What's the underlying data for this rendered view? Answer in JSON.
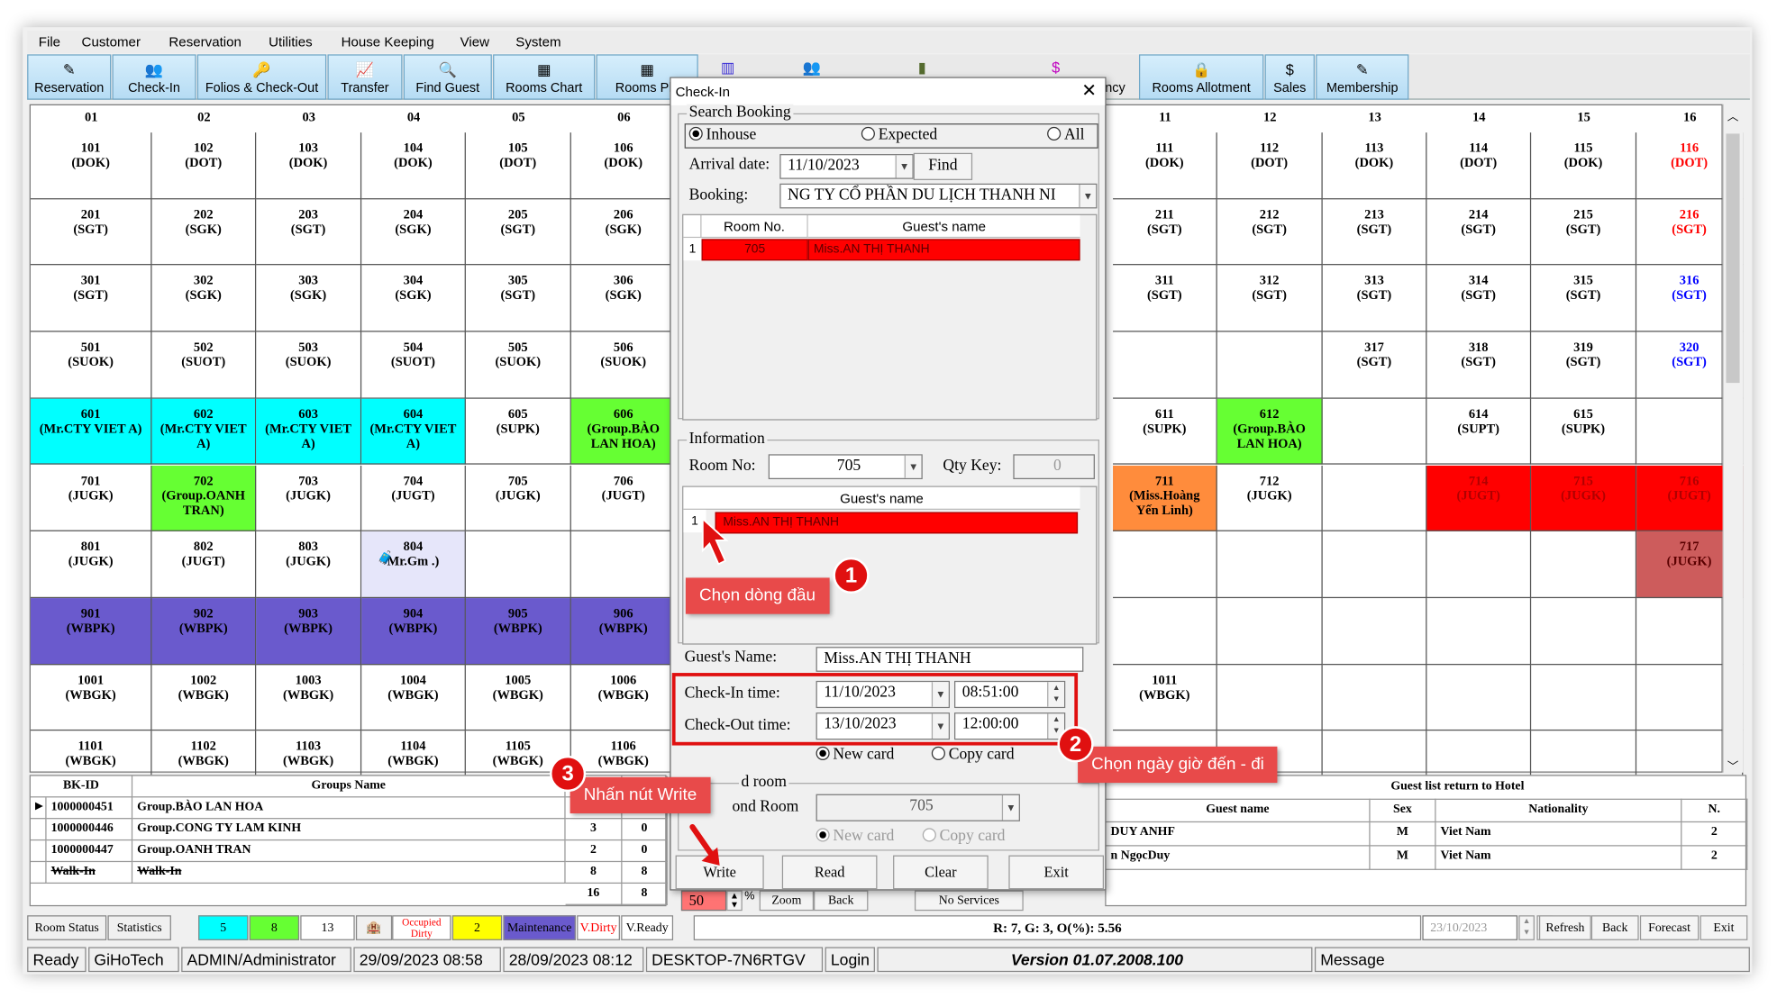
{
  "menu": [
    "File",
    "Customer",
    "Reservation",
    "Utilities",
    "House Keeping",
    "View",
    "System"
  ],
  "toolbar": [
    {
      "label": "Reservation",
      "icon": "✎"
    },
    {
      "label": "Check-In",
      "icon": "👥"
    },
    {
      "label": "Folios & Check-Out",
      "icon": "🔑"
    },
    {
      "label": "Transfer",
      "icon": "📈"
    },
    {
      "label": "Find Guest",
      "icon": "🔍"
    },
    {
      "label": "Rooms Chart",
      "icon": "▦"
    },
    {
      "label": "Rooms Pla",
      "icon": "▦"
    },
    {
      "label": "",
      "icon": "▥"
    },
    {
      "label": "",
      "icon": "👥"
    },
    {
      "label": "",
      "icon": "▮"
    },
    {
      "label": "",
      "icon": "$"
    },
    {
      "label": "ncy",
      "icon": ""
    },
    {
      "label": "Rooms Allotment",
      "icon": "🔒"
    },
    {
      "label": "Sales",
      "icon": "$"
    },
    {
      "label": "Membership",
      "icon": "✎"
    }
  ],
  "grid": {
    "left_headers": [
      "01",
      "02",
      "03",
      "04",
      "05",
      "06"
    ],
    "right_headers": [
      "11",
      "12",
      "13",
      "14",
      "15",
      "16"
    ],
    "left_rows": [
      [
        {
          "t": "101\n(DOK)"
        },
        {
          "t": "102\n(DOT)"
        },
        {
          "t": "103\n(DOK)"
        },
        {
          "t": "104\n(DOK)"
        },
        {
          "t": "105\n(DOT)"
        },
        {
          "t": "106\n(DOK)"
        }
      ],
      [
        {
          "t": "201\n(SGT)"
        },
        {
          "t": "202\n(SGK)"
        },
        {
          "t": "203\n(SGT)"
        },
        {
          "t": "204\n(SGK)"
        },
        {
          "t": "205\n(SGT)"
        },
        {
          "t": "206\n(SGK)"
        }
      ],
      [
        {
          "t": "301\n(SGT)"
        },
        {
          "t": "302\n(SGK)"
        },
        {
          "t": "303\n(SGK)"
        },
        {
          "t": "304\n(SGK)"
        },
        {
          "t": "305\n(SGT)"
        },
        {
          "t": "306\n(SGK)"
        }
      ],
      [
        {
          "t": "501\n(SUOK)"
        },
        {
          "t": "502\n(SUOT)"
        },
        {
          "t": "503\n(SUOK)"
        },
        {
          "t": "504\n(SUOT)"
        },
        {
          "t": "505\n(SUOK)"
        },
        {
          "t": "506\n(SUOK)"
        }
      ],
      [
        {
          "t": "601\n(Mr.CTY VIET A)",
          "bg": "#00ffff"
        },
        {
          "t": "602\n(Mr.CTY VIET\nA)",
          "bg": "#00ffff"
        },
        {
          "t": "603\n(Mr.CTY VIET\nA)",
          "bg": "#00ffff"
        },
        {
          "t": "604\n(Mr.CTY VIET\nA)",
          "bg": "#00ffff"
        },
        {
          "t": "605\n(SUPK)"
        },
        {
          "t": "606\n(Group.BÀO\nLAN HOA)",
          "bg": "#66ff33"
        }
      ],
      [
        {
          "t": "701\n(JUGK)"
        },
        {
          "t": "702\n(Group.OANH\nTRAN)",
          "bg": "#66ff33"
        },
        {
          "t": "703\n(JUGK)"
        },
        {
          "t": "704\n(JUGT)"
        },
        {
          "t": "705\n(JUGK)"
        },
        {
          "t": "706\n(JUGT)"
        }
      ],
      [
        {
          "t": "801\n(JUGK)"
        },
        {
          "t": "802\n(JUGT)"
        },
        {
          "t": "803\n(JUGK)"
        },
        {
          "t": "804\nMr.Gm .)",
          "bg": "#e6e6fa",
          "ico": true
        },
        {
          "t": ""
        },
        {
          "t": ""
        }
      ],
      [
        {
          "t": "901\n(WBPK)",
          "bg": "#6a5acd"
        },
        {
          "t": "902\n(WBPK)",
          "bg": "#6a5acd"
        },
        {
          "t": "903\n(WBPK)",
          "bg": "#6a5acd"
        },
        {
          "t": "904\n(WBPK)",
          "bg": "#6a5acd"
        },
        {
          "t": "905\n(WBPK)",
          "bg": "#6a5acd"
        },
        {
          "t": "906\n(WBPK)",
          "bg": "#6a5acd"
        }
      ],
      [
        {
          "t": "1001\n(WBGK)"
        },
        {
          "t": "1002\n(WBGK)"
        },
        {
          "t": "1003\n(WBGK)"
        },
        {
          "t": "1004\n(WBGK)"
        },
        {
          "t": "1005\n(WBGK)"
        },
        {
          "t": "1006\n(WBGK)"
        }
      ],
      [
        {
          "t": "1101\n(WBGK)"
        },
        {
          "t": "1102\n(WBGK)"
        },
        {
          "t": "1103\n(WBGK)"
        },
        {
          "t": "1104\n(WBGK)"
        },
        {
          "t": "1105\n(WBGK)"
        },
        {
          "t": "1106\n(WBGK)"
        }
      ]
    ],
    "right_rows": [
      [
        {
          "t": "111\n(DOK)"
        },
        {
          "t": "112\n(DOT)"
        },
        {
          "t": "113\n(DOK)"
        },
        {
          "t": "114\n(DOT)"
        },
        {
          "t": "115\n(DOK)"
        },
        {
          "t": "116\n(DOT)",
          "fg": "#ff0000"
        }
      ],
      [
        {
          "t": "211\n(SGT)"
        },
        {
          "t": "212\n(SGT)"
        },
        {
          "t": "213\n(SGT)"
        },
        {
          "t": "214\n(SGT)"
        },
        {
          "t": "215\n(SGT)"
        },
        {
          "t": "216\n(SGT)",
          "fg": "#ff0000"
        }
      ],
      [
        {
          "t": "311\n(SGT)"
        },
        {
          "t": "312\n(SGT)"
        },
        {
          "t": "313\n(SGT)"
        },
        {
          "t": "314\n(SGT)"
        },
        {
          "t": "315\n(SGT)"
        },
        {
          "t": "316\n(SGT)",
          "fg": "#0000ff"
        }
      ],
      [
        {
          "t": ""
        },
        {
          "t": ""
        },
        {
          "t": "317\n(SGT)"
        },
        {
          "t": "318\n(SGT)"
        },
        {
          "t": "319\n(SGT)"
        },
        {
          "t": "320\n(SGT)",
          "fg": "#0000ff"
        }
      ],
      [
        {
          "t": "611\n(SUPK)"
        },
        {
          "t": "612\n(Group.BÀO\nLAN HOA)",
          "bg": "#66ff33"
        },
        {
          "t": ""
        },
        {
          "t": "614\n(SUPT)"
        },
        {
          "t": "615\n(SUPK)"
        },
        {
          "t": ""
        }
      ],
      [
        {
          "t": "711\n(Miss.Hoàng\nYến Linh)",
          "bg": "#ff8c3c"
        },
        {
          "t": "712\n(JUGK)"
        },
        {
          "t": ""
        },
        {
          "t": "714\n(JUGT)",
          "bg": "#ff0000",
          "fg": "#b00000"
        },
        {
          "t": "715\n(JUGK)",
          "bg": "#ff0000",
          "fg": "#b00000"
        },
        {
          "t": "716\n(JUGT)",
          "bg": "#ff0000",
          "fg": "#b00000"
        }
      ],
      [
        {
          "t": ""
        },
        {
          "t": ""
        },
        {
          "t": ""
        },
        {
          "t": ""
        },
        {
          "t": ""
        },
        {
          "t": "717\n(JUGK)",
          "bg": "#cd5c5c",
          "fg": "#5a0000"
        }
      ],
      [
        {
          "t": ""
        },
        {
          "t": ""
        },
        {
          "t": ""
        },
        {
          "t": ""
        },
        {
          "t": ""
        },
        {
          "t": ""
        }
      ],
      [
        {
          "t": "1011\n(WBGK)"
        },
        {
          "t": ""
        },
        {
          "t": ""
        },
        {
          "t": ""
        },
        {
          "t": ""
        },
        {
          "t": ""
        }
      ],
      [
        {
          "t": ""
        },
        {
          "t": ""
        },
        {
          "t": ""
        },
        {
          "t": ""
        },
        {
          "t": ""
        },
        {
          "t": ""
        }
      ]
    ]
  },
  "groups_table": {
    "headers": [
      "BK-ID",
      "Groups Name"
    ],
    "rows": [
      {
        "id": "1000000451",
        "name": "Group.BÀO LAN HOA",
        "a": "",
        "b": ""
      },
      {
        "id": "1000000446",
        "name": "Group.CONG TY LAM KINH",
        "a": "3",
        "b": "0"
      },
      {
        "id": "1000000447",
        "name": "Group.OANH TRAN",
        "a": "2",
        "b": "0"
      },
      {
        "id": "Walk-In",
        "name": "Walk-In",
        "a": "8",
        "b": "8"
      }
    ],
    "totals": [
      "16",
      "8"
    ]
  },
  "guest_return": {
    "title": "Guest list return to Hotel",
    "headers": [
      "Guest name",
      "Sex",
      "Nationality",
      "N."
    ],
    "rows": [
      {
        "name": "DUY ANHF",
        "sex": "M",
        "nat": "Viet Nam",
        "n": "2"
      },
      {
        "name": "n NgọcDuy",
        "sex": "M",
        "nat": "Viet Nam",
        "n": "2"
      }
    ]
  },
  "dialog": {
    "title": "Check-In",
    "search_label": "Search Booking",
    "radio_inhouse": "Inhouse",
    "radio_expected": "Expected",
    "radio_all": "All",
    "arrival_label": "Arrival date:",
    "arrival_value": "11/10/2023",
    "find_label": "Find",
    "booking_label": "Booking:",
    "booking_value": "NG TY CỔ PHẦN DU LỊCH THANH NI",
    "col_room": "Room No.",
    "col_guest": "Guest's name",
    "row_index": "1",
    "row_room": "705",
    "row_guest": "Miss.AN THỊ THANH",
    "info_label": "Information",
    "roomno_label": "Room No:",
    "roomno_value": "705",
    "qty_label": "Qty Key:",
    "qty_value": "0",
    "guest_col": "Guest's name",
    "guest_row_index": "1",
    "guest_row_name": "Miss.AN THỊ THANH",
    "guestname_label": "Guest's Name:",
    "guestname_value": "Miss.AN THỊ THANH",
    "checkin_label": "Check-In time:",
    "checkin_date": "11/10/2023",
    "checkin_time": "08:51:00",
    "checkout_label": "Check-Out time:",
    "checkout_date": "13/10/2023",
    "checkout_time": "12:00:00",
    "newcard": "New card",
    "copycard": "Copy card",
    "second_label": "d room",
    "second_room_label": "ond Room",
    "second_room_value": "705",
    "newcard2": "New card",
    "copycard2": "Copy card",
    "btn_write": "Write",
    "btn_read": "Read",
    "btn_clear": "Clear",
    "btn_exit": "Exit"
  },
  "under_dialog": {
    "spin": "50",
    "pct": "%",
    "zoom": "Zoom",
    "back": "Back",
    "noservices": "No Services"
  },
  "legend": [
    {
      "t": "Room Status",
      "bg": "#f0f0f0"
    },
    {
      "t": "Statistics",
      "bg": "#f0f0f0"
    },
    {
      "t": "5",
      "bg": "#00ffff"
    },
    {
      "t": "8",
      "bg": "#66ff33"
    },
    {
      "t": "13",
      "bg": "#ffffff"
    },
    {
      "t": "",
      "bg": "#f0f0f0"
    },
    {
      "t": "Occupied Dirty",
      "bg": "#ffffff",
      "fg": "#ff0000"
    },
    {
      "t": "2",
      "bg": "#ffff00"
    },
    {
      "t": "Maintenance",
      "bg": "#6a5acd"
    },
    {
      "t": "V.Dirty",
      "bg": "#ffffff",
      "fg": "#ff0000"
    },
    {
      "t": "V.Ready",
      "bg": "#ffffff"
    }
  ],
  "ratio_text": "R: 7, G: 3, O(%): 5.56",
  "bottom_right": {
    "date": "23/10/2023",
    "refresh": "Refresh",
    "back": "Back",
    "forecast": "Forecast",
    "exit": "Exit"
  },
  "status": [
    "Ready",
    "GiHoTech",
    "ADMIN/Administrator",
    "29/09/2023 08:58",
    "28/09/2023 08:12",
    "DESKTOP-7N6RTGV",
    "Login",
    "Version 01.07.2008.100",
    "Message"
  ],
  "annotations": {
    "c1": "Chọn dòng đầu",
    "c2": "Chọn ngày giờ đến - đi",
    "c3": "Nhấn nút Write",
    "n1": "1",
    "n2": "2",
    "n3": "3"
  },
  "colors": {
    "toolbar_grad": "#b6dcf4",
    "callout": "#e84a4a",
    "badge": "#e01010"
  }
}
